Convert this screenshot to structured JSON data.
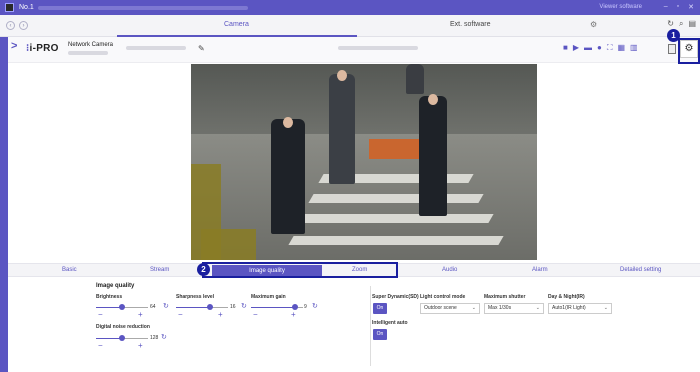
{
  "window": {
    "title": "No.1",
    "right_text": "Viewer software"
  },
  "tabs": {
    "camera": "Camera",
    "ext_software": "Ext. software"
  },
  "header": {
    "logo_text": "i-PRO",
    "product_label": "Network Camera"
  },
  "badges": {
    "one": "1",
    "two": "2"
  },
  "subtabs": {
    "basic": "Basic",
    "stream": "Stream",
    "image_quality": "Image quality",
    "zoom": "Zoom",
    "audio": "Audio",
    "alarm": "Alarm",
    "detailed": "Detailed setting"
  },
  "panel": {
    "section_title": "Image quality",
    "brightness": {
      "label": "Brightness",
      "value": "64",
      "level": 0.5
    },
    "sharpness": {
      "label": "Sharpness level",
      "value": "16",
      "level": 0.65
    },
    "max_gain": {
      "label": "Maximum gain",
      "value": "9",
      "level": 0.85
    },
    "noise": {
      "label": "Digital noise reduction",
      "value": "128",
      "level": 0.5
    },
    "super_dynamic": {
      "label": "Super Dynamic(SD)",
      "state": "On"
    },
    "light_mode": {
      "label": "Light control mode",
      "value": "Outdoor scene"
    },
    "max_shutter": {
      "label": "Maximum shutter",
      "value": "Max 1/30s"
    },
    "day_night": {
      "label": "Day & Night(IR)",
      "value": "Auto1(IR Light)"
    },
    "intelligent_auto": {
      "label": "Intelligent auto",
      "state": "On"
    }
  },
  "colors": {
    "accent": "#5b55c2",
    "highlight": "#1a1f9f"
  }
}
